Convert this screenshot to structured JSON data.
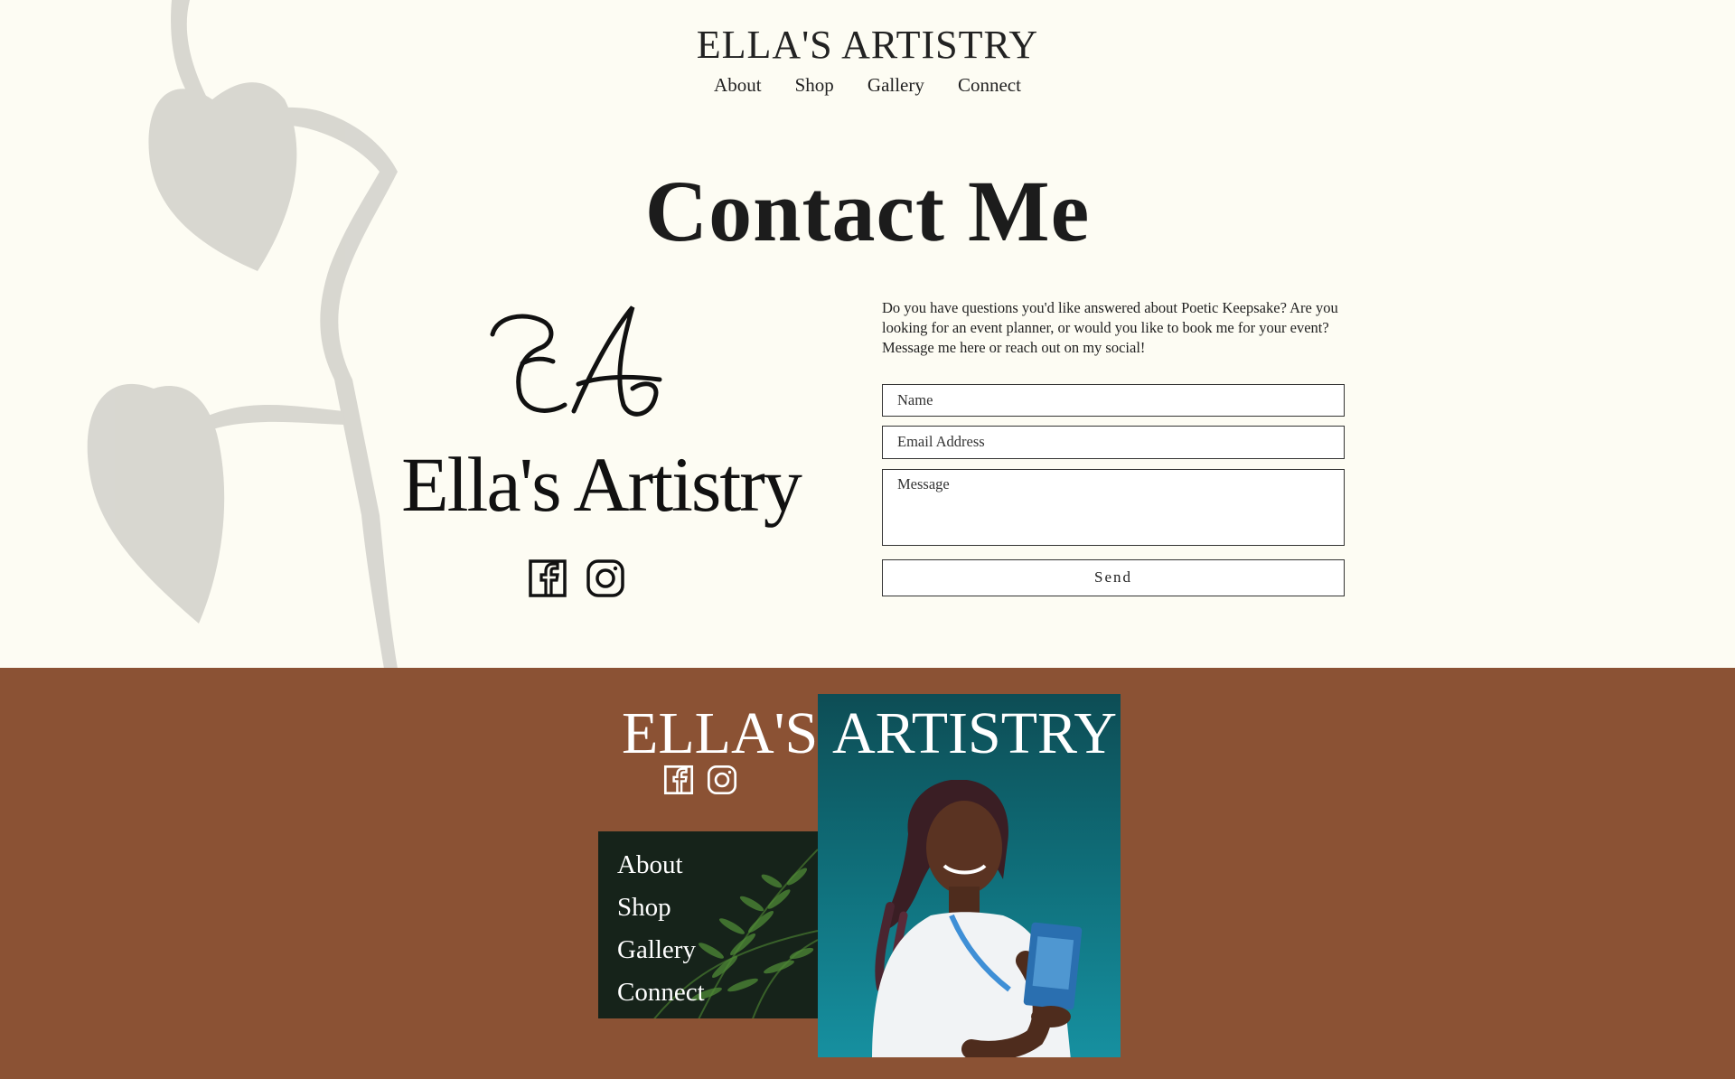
{
  "header": {
    "title": "ELLA'S ARTISTRY",
    "nav": [
      "About",
      "Shop",
      "Gallery",
      "Connect"
    ]
  },
  "page_heading": "Contact Me",
  "logo": {
    "monogram": "EA",
    "brand_name": "Ella's Artistry",
    "social_icons": [
      "facebook-icon",
      "instagram-icon"
    ]
  },
  "contact": {
    "intro": "Do you have questions you'd like answered about Poetic Keepsake? Are you looking for an event planner, or would you like to book me for your event? Message me here or reach out on my social!",
    "name_placeholder": "Name",
    "email_placeholder": "Email Address",
    "message_placeholder": "Message",
    "send_label": "Send"
  },
  "footer": {
    "word_left": "ELLA'S",
    "word_right": "ARTISTRY",
    "nav": [
      "About",
      "Shop",
      "Gallery",
      "Connect"
    ],
    "social_icons": [
      "facebook-icon",
      "instagram-icon"
    ]
  },
  "colors": {
    "background": "#fdfcf3",
    "footer": "#8b5234",
    "text": "#1c1c1c",
    "photo_bg": "#0f6c77"
  }
}
